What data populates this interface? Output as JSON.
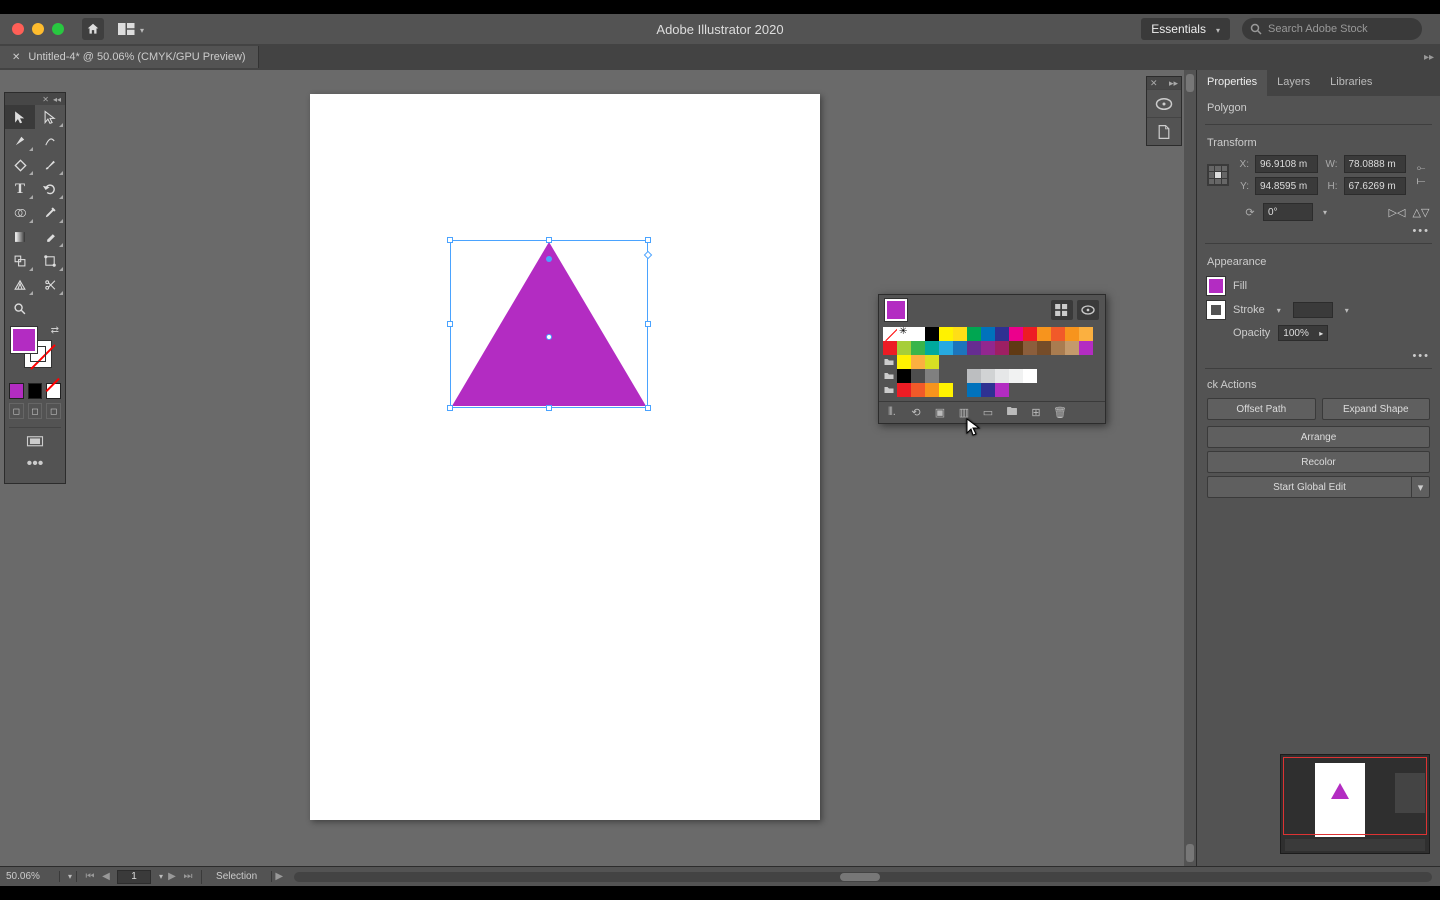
{
  "app": {
    "title": "Adobe Illustrator 2020",
    "workspace": "Essentials",
    "stock_placeholder": "Search Adobe Stock"
  },
  "document": {
    "tab_title": "Untitled-4* @ 50.06% (CMYK/GPU Preview)"
  },
  "status": {
    "zoom": "50.06%",
    "page": "1",
    "tool": "Selection"
  },
  "selection": {
    "type_label": "Polygon",
    "shape_fill": "#b32cc2"
  },
  "panels": {
    "tabs": {
      "properties": "Properties",
      "layers": "Layers",
      "libraries": "Libraries"
    },
    "transform": {
      "title": "Transform",
      "x_label": "X:",
      "y_label": "Y:",
      "w_label": "W:",
      "h_label": "H:",
      "x": "96.9108 m",
      "y": "94.8595 m",
      "w": "78.0888 m",
      "h": "67.6269 m",
      "rotation": "0°"
    },
    "appearance": {
      "title": "Appearance",
      "fill_label": "Fill",
      "stroke_label": "Stroke",
      "opacity_label": "Opacity",
      "opacity": "100%",
      "stroke_weight": ""
    },
    "quick_actions": {
      "title": "ck Actions",
      "offset_path": "Offset Path",
      "expand_shape": "Expand Shape",
      "arrange": "Arrange",
      "recolor": "Recolor",
      "start_global_edit": "Start Global Edit"
    }
  },
  "swatches": {
    "row1": [
      "none",
      "reg",
      "#ffffff",
      "#000000",
      "#fff200",
      "#ffde17",
      "#00a651",
      "#0072bc",
      "#2e3192",
      "#ec008c",
      "#ed1c24",
      "#f7941d",
      "#f15a29",
      "#f7941d",
      "#fbb040"
    ],
    "row2": [
      "#ed1c24",
      "#a6ce39",
      "#39b54a",
      "#00a99d",
      "#27aae1",
      "#1c75bc",
      "#662d91",
      "#92278f",
      "#9e1f63",
      "#603913",
      "#8b5e3c",
      "#754c29",
      "#a97c50",
      "#c49a6c",
      "#b32cc2"
    ],
    "row3": [
      "group",
      "#fff200",
      "#fbb040",
      "#d7df23"
    ],
    "row4": [
      "group",
      "#000000",
      "#4d4d4d",
      "#808080",
      "",
      "",
      "#bcbec0",
      "#d1d3d4",
      "#e6e7e8",
      "#f1f2f2",
      "#ffffff"
    ],
    "row5": [
      "group",
      "#ed1c24",
      "#f15a29",
      "#f7941d",
      "#fff200",
      "",
      "#0072bc",
      "#2e3192",
      "#b32cc2"
    ]
  }
}
